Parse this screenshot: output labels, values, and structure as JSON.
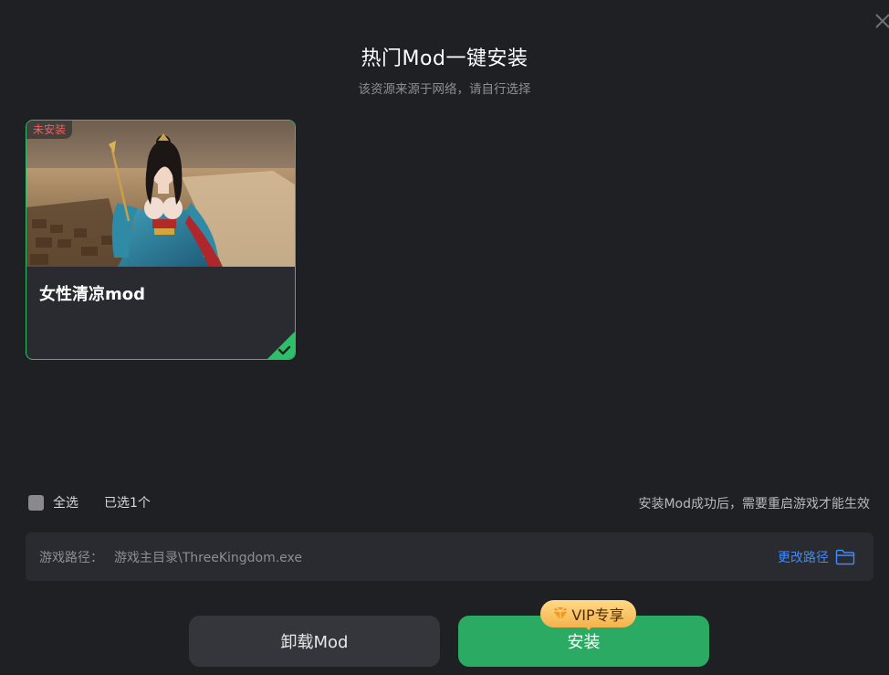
{
  "dialog": {
    "title": "热门Mod一键安装",
    "subtitle": "该资源来源于网络，请自行选择"
  },
  "mods": [
    {
      "name": "女性清凉mod",
      "status": "未安装",
      "selected": true
    }
  ],
  "selection": {
    "select_all_label": "全选",
    "selected_count": "已选1个",
    "note": "安装Mod成功后，需要重启游戏才能生效"
  },
  "path": {
    "label": "游戏路径：",
    "value": "游戏主目录\\ThreeKingdom.exe",
    "change_label": "更改路径"
  },
  "actions": {
    "uninstall_label": "卸载Mod",
    "install_label": "安装",
    "vip_label": "VIP专享"
  },
  "colors": {
    "background": "#1f2024",
    "accent_green": "#2aaa63",
    "link_blue": "#3d8bfd",
    "status_red": "#ff5b5b",
    "vip_gold": "#f5b24d"
  },
  "icons": [
    "close-icon",
    "checkmark-icon",
    "folder-icon",
    "diamond-icon"
  ]
}
